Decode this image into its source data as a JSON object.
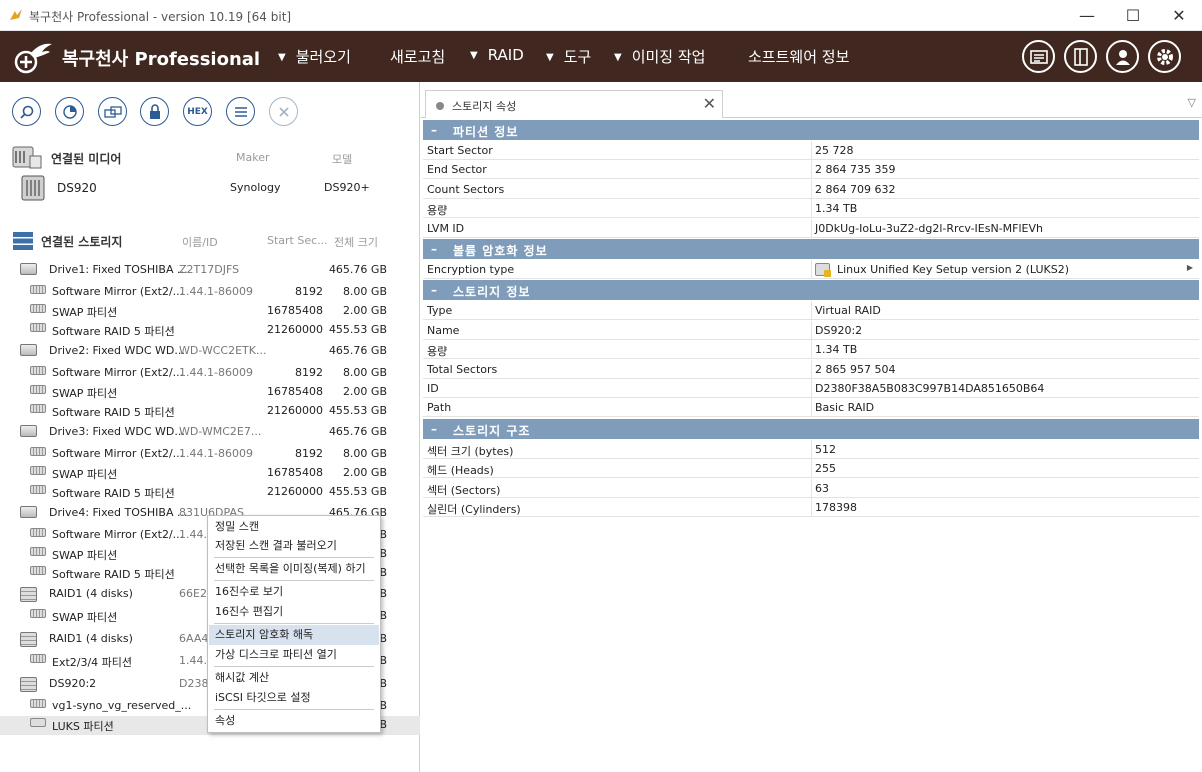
{
  "window": {
    "title": "복구천사 Professional - version 10.19 [64 bit]",
    "min_glyph": "—",
    "max_glyph": "☐",
    "close_glyph": "✕"
  },
  "menubar": {
    "brand": "복구천사 Professional",
    "items": [
      {
        "label": "불러오기",
        "has_arrow": true
      },
      {
        "label": "새로고침",
        "has_arrow": false
      },
      {
        "label": "RAID",
        "has_arrow": true
      },
      {
        "label": "도구",
        "has_arrow": true
      },
      {
        "label": "이미징 작업",
        "has_arrow": true
      },
      {
        "label": "소프트웨어 정보",
        "has_arrow": false
      }
    ],
    "arrow_glyph": "▼",
    "right_icons": [
      "window-icon",
      "panel-icon",
      "user-icon",
      "gear-icon"
    ]
  },
  "toolbar": {
    "icons": [
      "search-icon",
      "scan-icon",
      "image-icon",
      "lock-icon",
      "hex-icon",
      "list-icon",
      "cancel-icon"
    ],
    "hex_label": "HEX"
  },
  "media": {
    "title": "연결된 미디어",
    "col_maker": "Maker",
    "col_model": "모델",
    "device": {
      "name": "DS920",
      "maker": "Synology",
      "model": "DS920+"
    }
  },
  "storage": {
    "title": "연결된 스토리지",
    "col_name": "이름/ID",
    "col_start": "Start Sec...",
    "col_size": "전체 크기",
    "rows": [
      {
        "kind": "disk",
        "label": "Drive1: Fixed TOSHIBA ...",
        "id": "Z2T17DJFS",
        "start": "",
        "size": "465.76 GB"
      },
      {
        "kind": "part",
        "label": "Software Mirror (Ext2/...",
        "id": "1.44.1-86009",
        "start": "8192",
        "size": "8.00 GB"
      },
      {
        "kind": "part",
        "label": "SWAP 파티션",
        "id": "",
        "start": "16785408",
        "size": "2.00 GB"
      },
      {
        "kind": "part",
        "label": "Software RAID 5 파티션",
        "id": "",
        "start": "21260000",
        "size": "455.53 GB"
      },
      {
        "kind": "disk",
        "label": "Drive2: Fixed WDC WD...",
        "id": "WD-WCC2ETK...",
        "start": "",
        "size": "465.76 GB"
      },
      {
        "kind": "part",
        "label": "Software Mirror (Ext2/...",
        "id": "1.44.1-86009",
        "start": "8192",
        "size": "8.00 GB"
      },
      {
        "kind": "part",
        "label": "SWAP 파티션",
        "id": "",
        "start": "16785408",
        "size": "2.00 GB"
      },
      {
        "kind": "part",
        "label": "Software RAID 5 파티션",
        "id": "",
        "start": "21260000",
        "size": "455.53 GB"
      },
      {
        "kind": "disk",
        "label": "Drive3: Fixed WDC WD...",
        "id": "WD-WMC2E7...",
        "start": "",
        "size": "465.76 GB"
      },
      {
        "kind": "part",
        "label": "Software Mirror (Ext2/...",
        "id": "1.44.1-86009",
        "start": "8192",
        "size": "8.00 GB"
      },
      {
        "kind": "part",
        "label": "SWAP 파티션",
        "id": "",
        "start": "16785408",
        "size": "2.00 GB"
      },
      {
        "kind": "part",
        "label": "Software RAID 5 파티션",
        "id": "",
        "start": "21260000",
        "size": "455.53 GB"
      },
      {
        "kind": "disk",
        "label": "Drive4: Fixed TOSHIBA ...",
        "id": "831U6DPAS",
        "start": "",
        "size": "465.76 GB"
      },
      {
        "kind": "part",
        "label": "Software Mirror (Ext2/...",
        "id": "1.44.1",
        "start": "",
        "size": "B"
      },
      {
        "kind": "part",
        "label": "SWAP 파티션",
        "id": "",
        "start": "",
        "size": "B"
      },
      {
        "kind": "part",
        "label": "Software RAID 5 파티션",
        "id": "",
        "start": "",
        "size": "B"
      },
      {
        "kind": "raid",
        "label": "RAID1 (4 disks)",
        "id": "66E21",
        "start": "",
        "size": "B"
      },
      {
        "kind": "part",
        "label": "SWAP 파티션",
        "id": "",
        "start": "",
        "size": "B"
      },
      {
        "kind": "raid",
        "label": "RAID1 (4 disks)",
        "id": "6AA4",
        "start": "",
        "size": "B"
      },
      {
        "kind": "part",
        "label": "Ext2/3/4 파티션",
        "id": "1.44.1",
        "start": "",
        "size": "B"
      },
      {
        "kind": "raid",
        "label": "DS920:2",
        "id": "D2380",
        "start": "",
        "size": "B"
      },
      {
        "kind": "part",
        "label": "vg1-syno_vg_reserved_...",
        "id": "",
        "start": "",
        "size": "B"
      },
      {
        "kind": "lock",
        "label": "LUKS 파티션",
        "id": "",
        "start": "",
        "size": "B"
      }
    ]
  },
  "context_menu": {
    "items": [
      "정밀 스캔",
      "저장된 스캔 결과 불러오기",
      "선택한 목록을 이미징(복제) 하기",
      "16진수로 보기",
      "16진수 편집기",
      "스토리지 암호화 해독",
      "가상 디스크로 파티션 열기",
      "해시값 계산",
      "iSCSI 타깃으로 설정",
      "속성"
    ]
  },
  "properties": {
    "tab_label": "스토리지 속성",
    "tab_close": "✕",
    "tab_menu": "▽",
    "groups": [
      {
        "title": "파티션 정보",
        "rows": [
          {
            "k": "Start Sector",
            "v": "25 728"
          },
          {
            "k": "End Sector",
            "v": "2 864 735 359"
          },
          {
            "k": "Count Sectors",
            "v": "2 864 709 632"
          },
          {
            "k": "용량",
            "v": "1.34 TB"
          },
          {
            "k": "LVM ID",
            "v": "J0DkUg-IoLu-3uZ2-dg2l-Rrcv-IEsN-MFlEVh"
          }
        ]
      },
      {
        "title": "볼륨 암호화 정보",
        "rows": [
          {
            "k": "Encryption type",
            "v": "Linux Unified Key Setup version 2 (LUKS2)"
          }
        ]
      },
      {
        "title": "스토리지 정보",
        "rows": [
          {
            "k": "Type",
            "v": "Virtual RAID"
          },
          {
            "k": "Name",
            "v": "DS920:2"
          },
          {
            "k": "용량",
            "v": "1.34 TB"
          },
          {
            "k": "Total Sectors",
            "v": "2 865 957 504"
          },
          {
            "k": "ID",
            "v": "D2380F38A5B083C997B14DA851650B64"
          },
          {
            "k": "Path",
            "v": "Basic RAID"
          }
        ]
      },
      {
        "title": "스토리지 구조",
        "rows": [
          {
            "k": "섹터 크기 (bytes)",
            "v": "512"
          },
          {
            "k": "헤드 (Heads)",
            "v": "255"
          },
          {
            "k": "섹터 (Sectors)",
            "v": "63"
          },
          {
            "k": "실린더 (Cylinders)",
            "v": "178398"
          }
        ]
      }
    ],
    "group_toggle": "–",
    "more_glyph": "▶"
  },
  "colors": {
    "menubar_bg": "#402820",
    "group_header_bg": "#7f9dbb",
    "accent_blue": "#2d5c95"
  }
}
